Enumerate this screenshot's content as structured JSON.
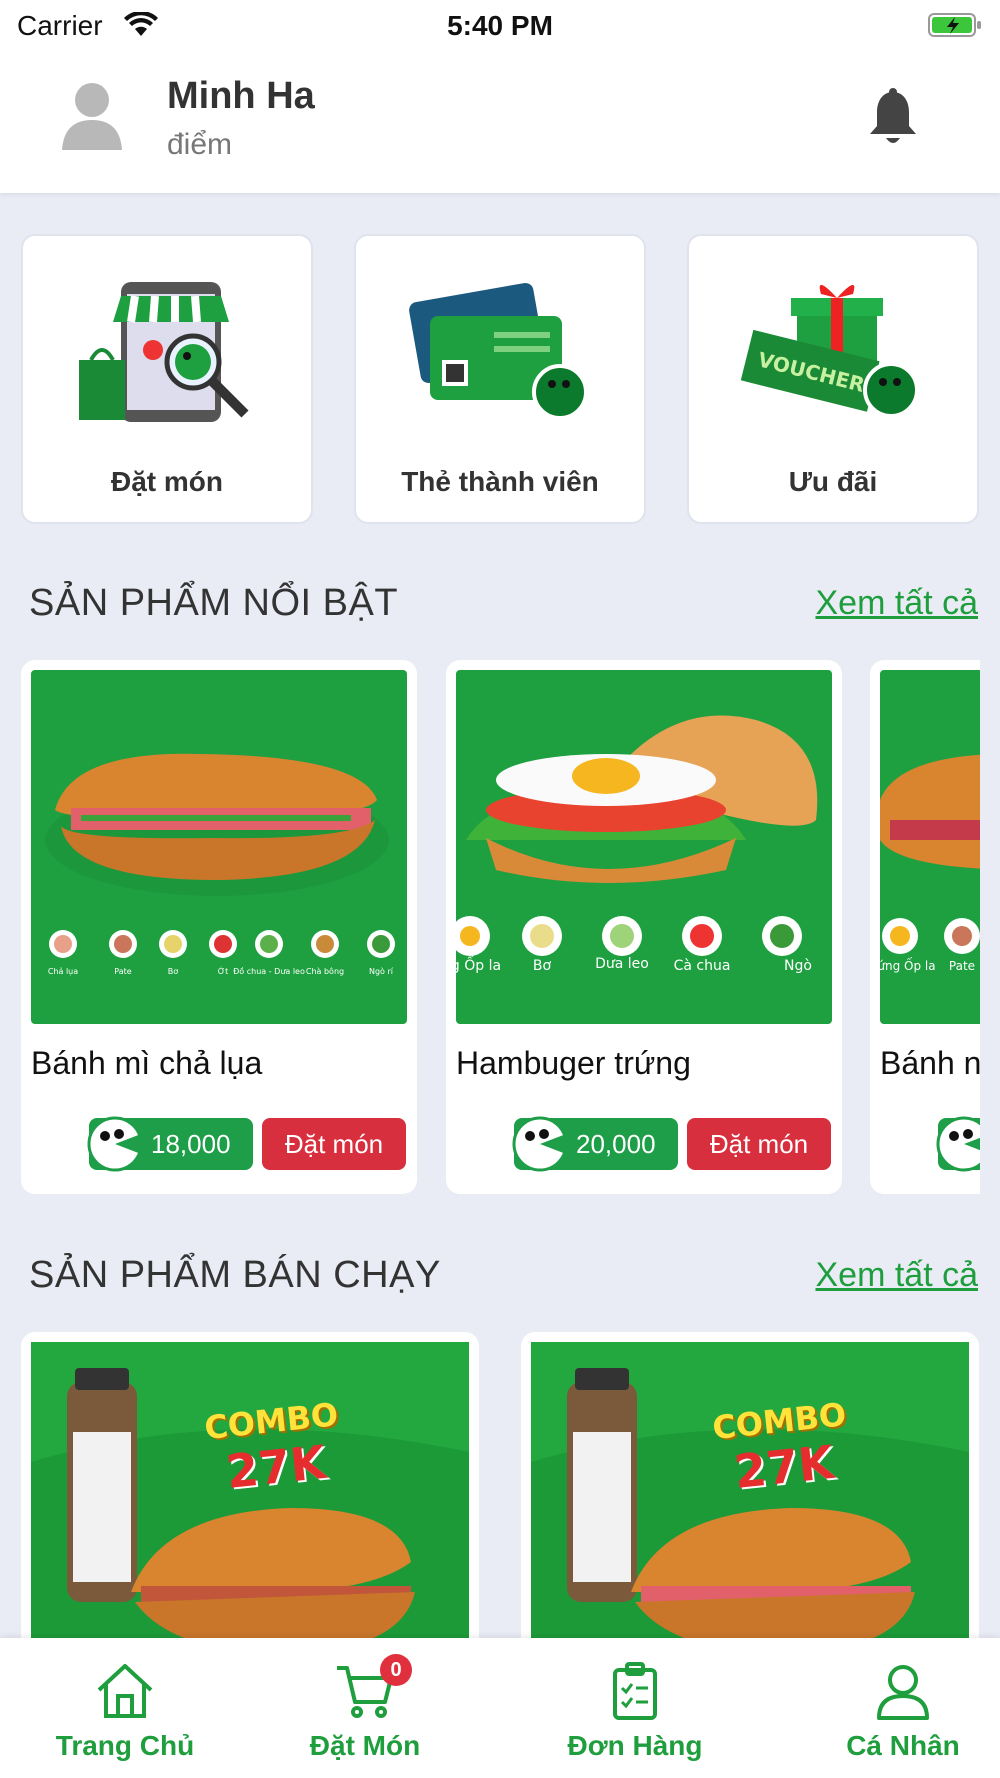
{
  "status_bar": {
    "carrier": "Carrier",
    "time": "5:40 PM"
  },
  "header": {
    "user_name": "Minh Ha",
    "points_label": "điểm"
  },
  "quick_actions": [
    {
      "label": "Đặt món"
    },
    {
      "label": "Thẻ thành viên"
    },
    {
      "label": "Ưu đãi"
    }
  ],
  "featured": {
    "title": "SẢN PHẨM NỔI BẬT",
    "see_all": "Xem tất cả",
    "products": [
      {
        "name": "Bánh mì chả lụa",
        "price": "18,000",
        "order_label": "Đặt món",
        "toppings": [
          "Chả lụa",
          "Pate",
          "Bơ",
          "Ớt",
          "Đồ chua - Dưa leo",
          "Chà bông",
          "Ngò rí"
        ]
      },
      {
        "name": "Hambuger trứng",
        "price": "20,000",
        "order_label": "Đặt món",
        "toppings": [
          "g Ốp la",
          "Bơ",
          "Dưa leo",
          "Cà chua",
          "Ngò"
        ]
      },
      {
        "name": "Bánh n",
        "price": "",
        "order_label": "",
        "toppings": [
          "rứng Ốp la",
          "Pate"
        ]
      }
    ]
  },
  "bestsellers": {
    "title": "SẢN PHẨM BÁN CHẠY",
    "see_all": "Xem tất cả",
    "products": [
      {
        "badge_line1": "COMBO",
        "badge_line2": "27K"
      },
      {
        "badge_line1": "COMBO",
        "badge_line2": "27K"
      }
    ]
  },
  "voucher_text": "VOUCHER",
  "tabbar": {
    "tabs": [
      {
        "label": "Trang Chủ",
        "icon": "home-icon"
      },
      {
        "label": "Đặt Món",
        "icon": "cart-icon"
      },
      {
        "label": "Đơn Hàng",
        "icon": "clipboard-icon"
      },
      {
        "label": "Cá Nhân",
        "icon": "person-icon"
      }
    ],
    "cart_count": "0"
  },
  "colors": {
    "brand_green": "#1e9e3c",
    "order_red": "#d82f3f",
    "background": "#e9ebf5"
  }
}
